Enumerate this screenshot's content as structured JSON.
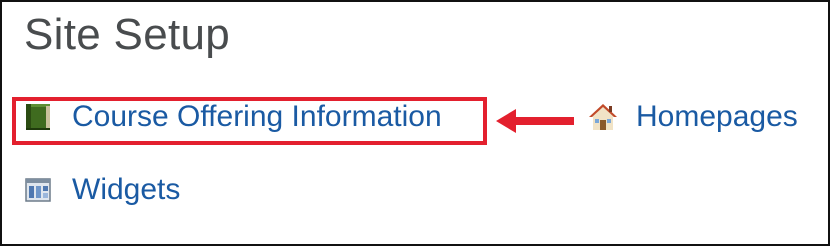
{
  "page": {
    "title": "Site Setup"
  },
  "links": {
    "course_offering": "Course Offering Information",
    "homepages": "Homepages",
    "widgets": "Widgets"
  },
  "icons": {
    "course_offering": "book-icon",
    "homepages": "house-icon",
    "widgets": "widgets-icon"
  },
  "annotation": {
    "highlight_color": "#e3202e",
    "arrow_color": "#e3202e"
  },
  "colors": {
    "title": "#494c4e",
    "link": "#1a5aa3"
  }
}
